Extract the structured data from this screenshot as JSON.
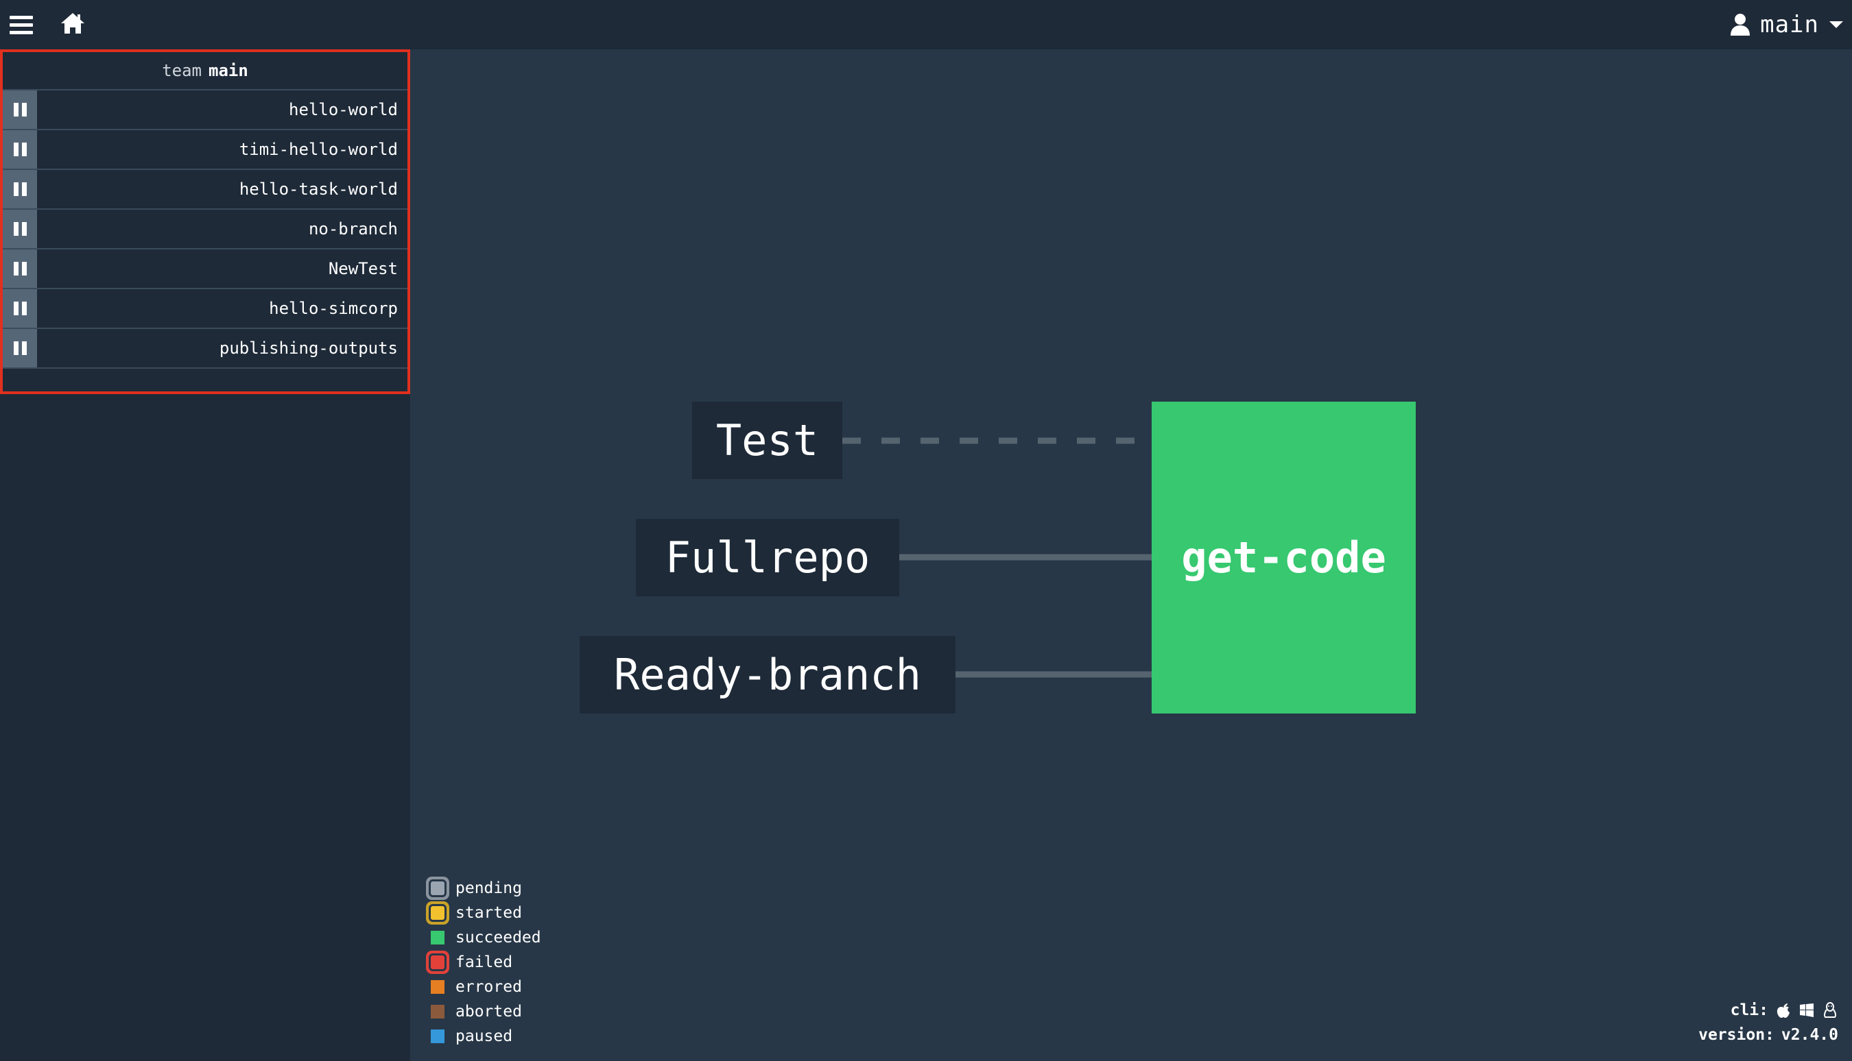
{
  "topbar": {
    "user_name": "main"
  },
  "sidebar": {
    "team_word": "team",
    "team_name": "main",
    "pipelines": [
      {
        "name": "hello-world"
      },
      {
        "name": "timi-hello-world"
      },
      {
        "name": "hello-task-world"
      },
      {
        "name": "no-branch"
      },
      {
        "name": "NewTest"
      },
      {
        "name": "hello-simcorp"
      },
      {
        "name": "publishing-outputs"
      }
    ]
  },
  "graph": {
    "inputs": [
      {
        "name": "Test",
        "edge": "dashed"
      },
      {
        "name": "Fullrepo",
        "edge": "solid"
      },
      {
        "name": "Ready-branch",
        "edge": "solid"
      }
    ],
    "job": {
      "name": "get-code",
      "status": "succeeded"
    }
  },
  "legend": [
    {
      "label": "pending",
      "color": "#9aa5b1",
      "ring": "#8a949e"
    },
    {
      "label": "started",
      "color": "#f2c12e",
      "ring": "#c9a227"
    },
    {
      "label": "succeeded",
      "color": "#37c870",
      "ring": null
    },
    {
      "label": "failed",
      "color": "#e2413a",
      "ring": "#e2413a"
    },
    {
      "label": "errored",
      "color": "#e67e22",
      "ring": null
    },
    {
      "label": "aborted",
      "color": "#8b5a3c",
      "ring": null
    },
    {
      "label": "paused",
      "color": "#3498db",
      "ring": null
    }
  ],
  "footer": {
    "cli_label": "cli:",
    "cli_icons": [
      "apple-icon",
      "windows-icon",
      "linux-icon"
    ],
    "version_label": "version:",
    "version_value": "v2.4.0"
  },
  "colors": {
    "background": "#273747",
    "panel": "#1e2a38",
    "highlight_border": "#e0301e",
    "success": "#37c870",
    "edge": "#56646f"
  }
}
